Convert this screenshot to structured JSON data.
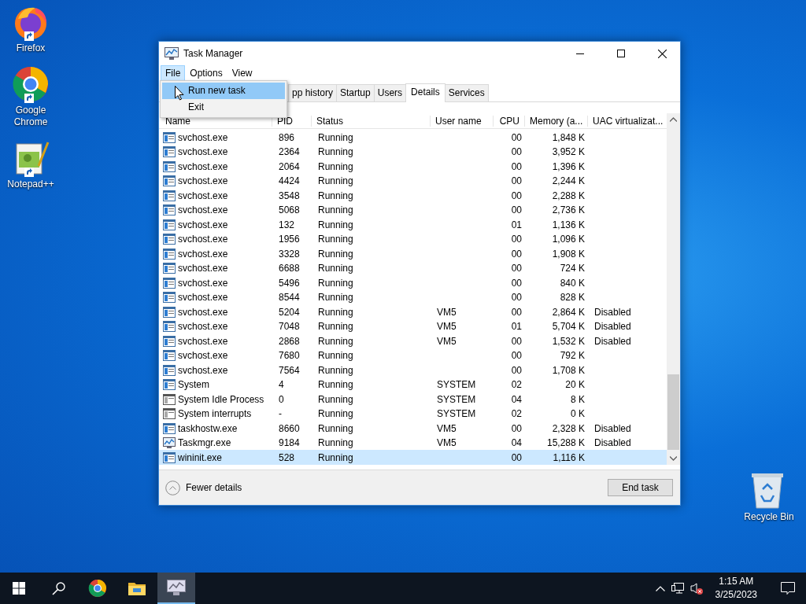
{
  "desktop_icons": [
    {
      "label": "Firefox",
      "kind": "firefox"
    },
    {
      "label": "Google Chrome",
      "kind": "chrome"
    },
    {
      "label": "Notepad++",
      "kind": "notepad"
    }
  ],
  "recycle_bin": {
    "label": "Recycle Bin"
  },
  "window": {
    "title": "Task Manager",
    "menu": [
      {
        "label": "File",
        "selected": true
      },
      {
        "label": "Options",
        "selected": false
      },
      {
        "label": "View",
        "selected": false
      }
    ],
    "file_menu": [
      {
        "label": "Run new task",
        "selected": true
      },
      {
        "label": "Exit",
        "selected": false
      }
    ],
    "tabs": [
      {
        "label": "pp history",
        "selected": false
      },
      {
        "label": "Startup",
        "selected": false
      },
      {
        "label": "Users",
        "selected": false
      },
      {
        "label": "Details",
        "selected": true
      },
      {
        "label": "Services",
        "selected": false
      }
    ],
    "table": {
      "columns": [
        "Name",
        "PID",
        "Status",
        "User name",
        "CPU",
        "Memory (a...",
        "UAC virtualizat..."
      ],
      "rows": [
        {
          "kind": "service",
          "name": "svchost.exe",
          "pid": "896",
          "status": "Running",
          "cpu": "00",
          "memory": "1,848 K",
          "selected": false
        },
        {
          "kind": "service",
          "name": "svchost.exe",
          "pid": "2364",
          "status": "Running",
          "cpu": "00",
          "memory": "3,952 K",
          "selected": false
        },
        {
          "kind": "service",
          "name": "svchost.exe",
          "pid": "2064",
          "status": "Running",
          "cpu": "00",
          "memory": "1,396 K",
          "selected": false
        },
        {
          "kind": "service",
          "name": "svchost.exe",
          "pid": "4424",
          "status": "Running",
          "cpu": "00",
          "memory": "2,244 K",
          "selected": false
        },
        {
          "kind": "service",
          "name": "svchost.exe",
          "pid": "3548",
          "status": "Running",
          "cpu": "00",
          "memory": "2,288 K",
          "selected": false
        },
        {
          "kind": "service",
          "name": "svchost.exe",
          "pid": "5068",
          "status": "Running",
          "cpu": "00",
          "memory": "2,736 K",
          "selected": false
        },
        {
          "kind": "service",
          "name": "svchost.exe",
          "pid": "132",
          "status": "Running",
          "cpu": "01",
          "memory": "1,136 K",
          "selected": false
        },
        {
          "kind": "service",
          "name": "svchost.exe",
          "pid": "1956",
          "status": "Running",
          "cpu": "00",
          "memory": "1,096 K",
          "selected": false
        },
        {
          "kind": "service",
          "name": "svchost.exe",
          "pid": "3328",
          "status": "Running",
          "cpu": "00",
          "memory": "1,908 K",
          "selected": false
        },
        {
          "kind": "service",
          "name": "svchost.exe",
          "pid": "6688",
          "status": "Running",
          "cpu": "00",
          "memory": "724 K",
          "selected": false
        },
        {
          "kind": "service",
          "name": "svchost.exe",
          "pid": "5496",
          "status": "Running",
          "cpu": "00",
          "memory": "840 K",
          "selected": false
        },
        {
          "kind": "service",
          "name": "svchost.exe",
          "pid": "8544",
          "status": "Running",
          "cpu": "00",
          "memory": "828 K",
          "selected": false
        },
        {
          "kind": "service",
          "name": "svchost.exe",
          "pid": "5204",
          "status": "Running",
          "user": "VM5",
          "cpu": "00",
          "memory": "2,864 K",
          "uac": "Disabled",
          "selected": false
        },
        {
          "kind": "service",
          "name": "svchost.exe",
          "pid": "7048",
          "status": "Running",
          "user": "VM5",
          "cpu": "01",
          "memory": "5,704 K",
          "uac": "Disabled",
          "selected": false
        },
        {
          "kind": "service",
          "name": "svchost.exe",
          "pid": "2868",
          "status": "Running",
          "user": "VM5",
          "cpu": "00",
          "memory": "1,532 K",
          "uac": "Disabled",
          "selected": false
        },
        {
          "kind": "service",
          "name": "svchost.exe",
          "pid": "7680",
          "status": "Running",
          "cpu": "00",
          "memory": "792 K",
          "selected": false
        },
        {
          "kind": "service",
          "name": "svchost.exe",
          "pid": "7564",
          "status": "Running",
          "cpu": "00",
          "memory": "1,708 K",
          "selected": false
        },
        {
          "kind": "service",
          "name": "System",
          "pid": "4",
          "status": "Running",
          "user": "SYSTEM",
          "cpu": "02",
          "memory": "20 K",
          "selected": false
        },
        {
          "kind": "system",
          "name": "System Idle Process",
          "pid": "0",
          "status": "Running",
          "user": "SYSTEM",
          "cpu": "04",
          "memory": "8 K",
          "selected": false
        },
        {
          "kind": "system",
          "name": "System interrupts",
          "pid": "-",
          "status": "Running",
          "user": "SYSTEM",
          "cpu": "02",
          "memory": "0 K",
          "selected": false
        },
        {
          "kind": "service",
          "name": "taskhostw.exe",
          "pid": "8660",
          "status": "Running",
          "user": "VM5",
          "cpu": "00",
          "memory": "2,328 K",
          "uac": "Disabled",
          "selected": false
        },
        {
          "kind": "taskmgr",
          "name": "Taskmgr.exe",
          "pid": "9184",
          "status": "Running",
          "user": "VM5",
          "cpu": "04",
          "memory": "15,288 K",
          "uac": "Disabled",
          "selected": false
        },
        {
          "kind": "service",
          "name": "wininit.exe",
          "pid": "528",
          "status": "Running",
          "cpu": "00",
          "memory": "1,116 K",
          "selected": true
        }
      ]
    },
    "footer": {
      "toggle": "Fewer details",
      "button": "End task"
    }
  },
  "taskbar": {
    "items": [
      {
        "kind": "start",
        "active": false
      },
      {
        "kind": "search",
        "active": false
      },
      {
        "kind": "chrome",
        "active": false
      },
      {
        "kind": "explorer",
        "active": false
      },
      {
        "kind": "taskmgr",
        "active": true
      }
    ],
    "tray": {
      "time": "1:15 AM",
      "date": "3/25/2023"
    }
  }
}
